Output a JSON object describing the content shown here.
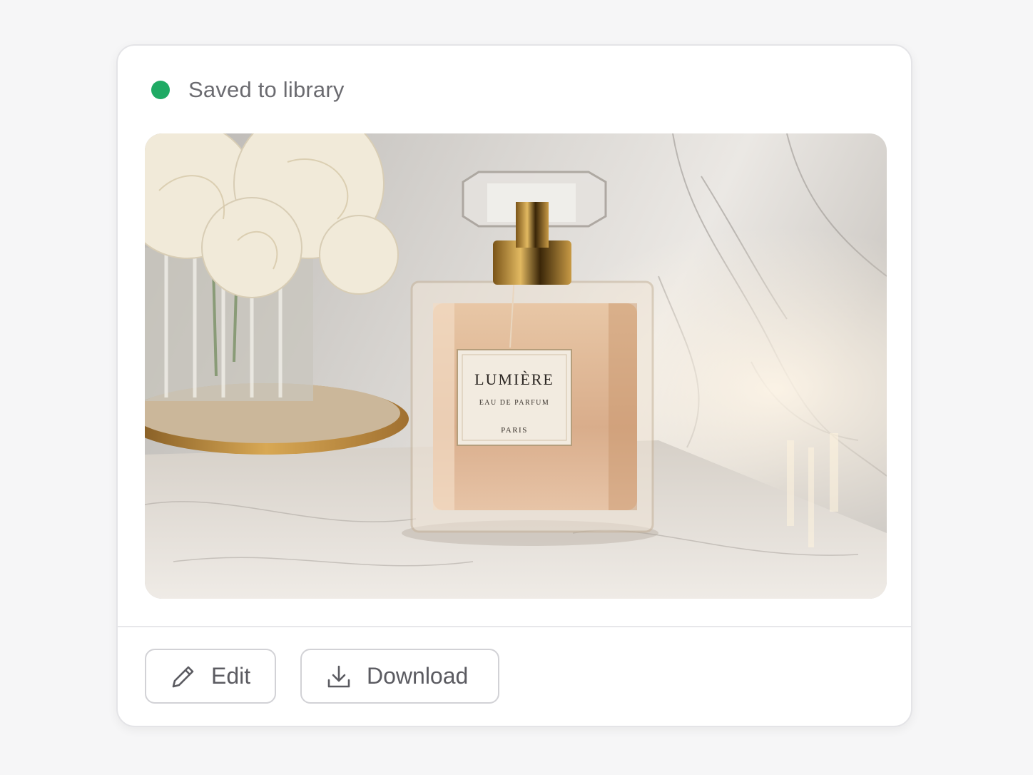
{
  "status": {
    "text": "Saved to library",
    "dot_color": "#1faa64",
    "dot_icon": "status-dot"
  },
  "image": {
    "label": {
      "brand": "LUMIÈRE",
      "type": "EAU DE PARFUM",
      "city": "PARIS"
    }
  },
  "actions": {
    "edit_label": "Edit",
    "edit_icon": "pencil-icon",
    "download_label": "Download",
    "download_icon": "download-icon"
  }
}
